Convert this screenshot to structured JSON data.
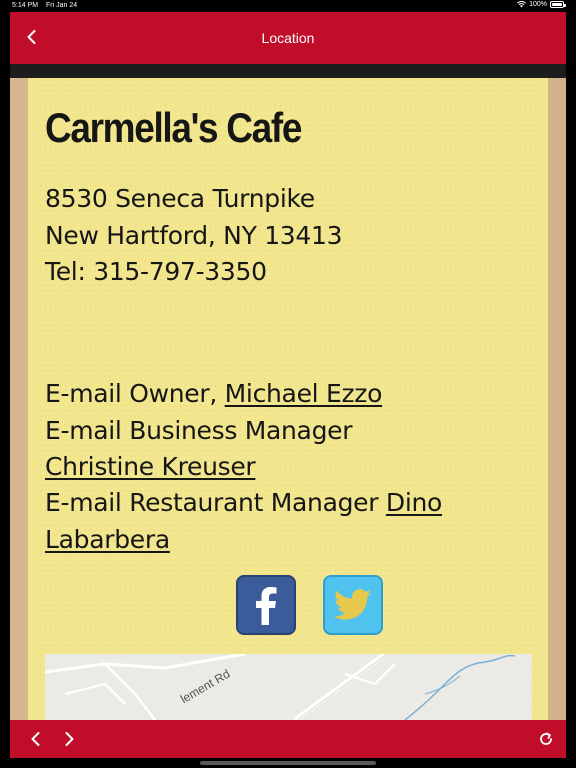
{
  "status_bar": {
    "time": "5:14 PM",
    "date": "Fri Jan 24",
    "battery": "100%"
  },
  "header": {
    "title": "Location",
    "back_icon": "chevron-left-icon"
  },
  "content": {
    "cafe_name": "Carmella's Cafe",
    "address_line1": "8530 Seneca Turnpike",
    "address_line2": "New Hartford, NY 13413",
    "phone": "Tel: 315-797-3350",
    "owner_prefix": "E-mail Owner, ",
    "owner_name": "Michael Ezzo",
    "business_manager_prefix": "E-mail Business Manager",
    "business_manager_name": "Christine Kreuser",
    "restaurant_manager_prefix": "E-mail Restaurant Manager ",
    "restaurant_manager_first": "Dino",
    "restaurant_manager_last": "Labarbera"
  },
  "social": {
    "facebook_icon": "facebook-icon",
    "twitter_icon": "twitter-icon",
    "facebook_color": "#3b5c9a",
    "twitter_color": "#4fc3ed"
  },
  "map": {
    "road_label": "lement Rd"
  },
  "colors": {
    "header": "#c00e2a",
    "paper": "#f2e68e"
  }
}
